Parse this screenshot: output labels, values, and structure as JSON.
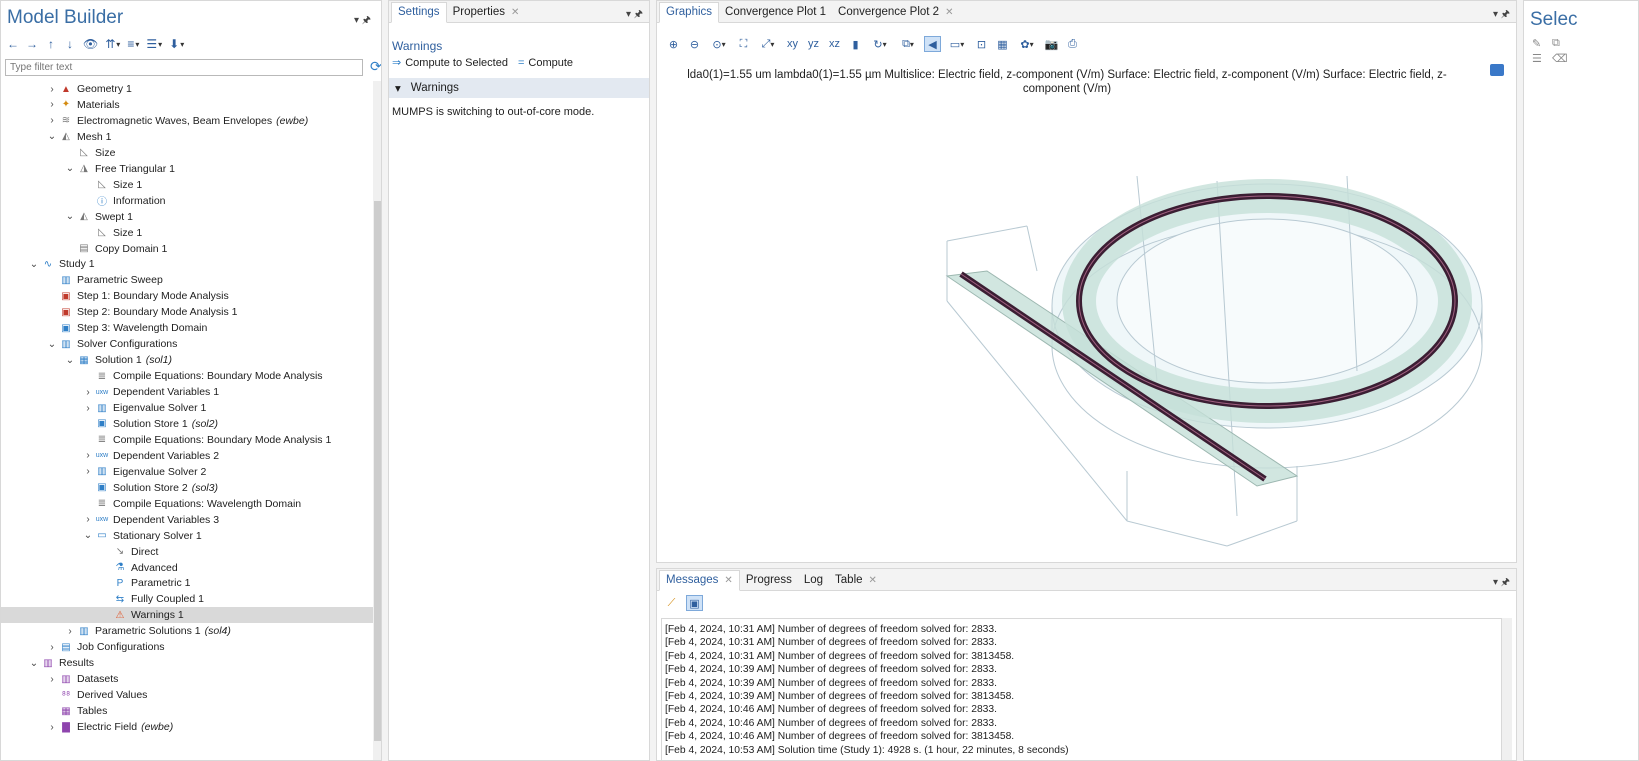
{
  "model_builder": {
    "title": "Model Builder",
    "filter_placeholder": "Type filter text",
    "toolbar_icons": [
      "arrow-left-icon",
      "arrow-right-icon",
      "arrow-up-icon",
      "arrow-down-icon",
      "visibility-icon",
      "expand-icon",
      "collapse-icon",
      "list-icon",
      "pin-icon"
    ],
    "tree": [
      {
        "label": "Geometry 1",
        "suffix": "",
        "level": 2,
        "tw": "›",
        "icon": "geometry-icon",
        "color": "#c0392b"
      },
      {
        "label": "Materials",
        "suffix": "",
        "level": 2,
        "tw": "›",
        "icon": "materials-icon",
        "color": "#d48b10"
      },
      {
        "label": "Electromagnetic Waves, Beam Envelopes",
        "suffix": "(ewbe)",
        "level": 2,
        "tw": "›",
        "icon": "waves-icon",
        "color": "#777"
      },
      {
        "label": "Mesh 1",
        "suffix": "",
        "level": 2,
        "tw": "⌄",
        "icon": "mesh-icon",
        "color": "#777"
      },
      {
        "label": "Size",
        "suffix": "",
        "level": 3,
        "tw": "",
        "icon": "size-icon",
        "color": "#777"
      },
      {
        "label": "Free Triangular 1",
        "suffix": "",
        "level": 3,
        "tw": "⌄",
        "icon": "triangular-icon",
        "color": "#777"
      },
      {
        "label": "Size 1",
        "suffix": "",
        "level": 4,
        "tw": "",
        "icon": "size-icon",
        "color": "#777"
      },
      {
        "label": "Information",
        "suffix": "",
        "level": 4,
        "tw": "",
        "icon": "info-icon",
        "color": "#2f7fc7"
      },
      {
        "label": "Swept 1",
        "suffix": "",
        "level": 3,
        "tw": "⌄",
        "icon": "swept-icon",
        "color": "#777"
      },
      {
        "label": "Size 1",
        "suffix": "",
        "level": 4,
        "tw": "",
        "icon": "size-icon",
        "color": "#777"
      },
      {
        "label": "Copy Domain 1",
        "suffix": "",
        "level": 3,
        "tw": "",
        "icon": "copy-domain-icon",
        "color": "#777"
      },
      {
        "label": "Study 1",
        "suffix": "",
        "level": 1,
        "tw": "⌄",
        "icon": "study-icon",
        "color": "#2f7fc7"
      },
      {
        "label": "Parametric Sweep",
        "suffix": "",
        "level": 2,
        "tw": "",
        "icon": "parametric-sweep-icon",
        "color": "#2f7fc7"
      },
      {
        "label": "Step 1: Boundary Mode Analysis",
        "suffix": "",
        "level": 2,
        "tw": "",
        "icon": "step-icon",
        "color": "#c0392b"
      },
      {
        "label": "Step 2: Boundary Mode Analysis 1",
        "suffix": "",
        "level": 2,
        "tw": "",
        "icon": "step-icon",
        "color": "#c0392b"
      },
      {
        "label": "Step 3: Wavelength Domain",
        "suffix": "",
        "level": 2,
        "tw": "",
        "icon": "step-icon",
        "color": "#2f7fc7"
      },
      {
        "label": "Solver Configurations",
        "suffix": "",
        "level": 2,
        "tw": "⌄",
        "icon": "solver-config-icon",
        "color": "#2f7fc7"
      },
      {
        "label": "Solution 1",
        "suffix": "(sol1)",
        "level": 3,
        "tw": "⌄",
        "icon": "solution-icon",
        "color": "#2f7fc7"
      },
      {
        "label": "Compile Equations: Boundary Mode Analysis",
        "suffix": "",
        "level": 4,
        "tw": "",
        "icon": "compile-icon",
        "color": "#777"
      },
      {
        "label": "Dependent Variables 1",
        "suffix": "",
        "level": 4,
        "tw": "›",
        "icon": "variables-icon",
        "color": "#2f7fc7"
      },
      {
        "label": "Eigenvalue Solver 1",
        "suffix": "",
        "level": 4,
        "tw": "›",
        "icon": "eigen-icon",
        "color": "#2f7fc7"
      },
      {
        "label": "Solution Store 1",
        "suffix": "(sol2)",
        "level": 4,
        "tw": "",
        "icon": "store-icon",
        "color": "#2f7fc7"
      },
      {
        "label": "Compile Equations: Boundary Mode Analysis 1",
        "suffix": "",
        "level": 4,
        "tw": "",
        "icon": "compile-icon",
        "color": "#777"
      },
      {
        "label": "Dependent Variables 2",
        "suffix": "",
        "level": 4,
        "tw": "›",
        "icon": "variables-icon",
        "color": "#2f7fc7"
      },
      {
        "label": "Eigenvalue Solver 2",
        "suffix": "",
        "level": 4,
        "tw": "›",
        "icon": "eigen-icon",
        "color": "#2f7fc7"
      },
      {
        "label": "Solution Store 2",
        "suffix": "(sol3)",
        "level": 4,
        "tw": "",
        "icon": "store-icon",
        "color": "#2f7fc7"
      },
      {
        "label": "Compile Equations: Wavelength Domain",
        "suffix": "",
        "level": 4,
        "tw": "",
        "icon": "compile-icon",
        "color": "#777"
      },
      {
        "label": "Dependent Variables 3",
        "suffix": "",
        "level": 4,
        "tw": "›",
        "icon": "variables-icon",
        "color": "#2f7fc7"
      },
      {
        "label": "Stationary Solver 1",
        "suffix": "",
        "level": 4,
        "tw": "⌄",
        "icon": "stationary-icon",
        "color": "#2f7fc7"
      },
      {
        "label": "Direct",
        "suffix": "",
        "level": 5,
        "tw": "",
        "icon": "direct-icon",
        "color": "#777"
      },
      {
        "label": "Advanced",
        "suffix": "",
        "level": 5,
        "tw": "",
        "icon": "advanced-icon",
        "color": "#2f7fc7"
      },
      {
        "label": "Parametric 1",
        "suffix": "",
        "level": 5,
        "tw": "",
        "icon": "parametric-icon",
        "color": "#2f7fc7"
      },
      {
        "label": "Fully Coupled 1",
        "suffix": "",
        "level": 5,
        "tw": "",
        "icon": "coupled-icon",
        "color": "#2f7fc7"
      },
      {
        "label": "Warnings 1",
        "suffix": "",
        "level": 5,
        "tw": "",
        "icon": "warning-icon",
        "color": "#e0572b",
        "selected": true
      },
      {
        "label": "Parametric Solutions 1",
        "suffix": "(sol4)",
        "level": 3,
        "tw": "›",
        "icon": "param-solutions-icon",
        "color": "#2f7fc7"
      },
      {
        "label": "Job Configurations",
        "suffix": "",
        "level": 2,
        "tw": "›",
        "icon": "job-icon",
        "color": "#2f7fc7"
      },
      {
        "label": "Results",
        "suffix": "",
        "level": 1,
        "tw": "⌄",
        "icon": "results-icon",
        "color": "#8e44ad"
      },
      {
        "label": "Datasets",
        "suffix": "",
        "level": 2,
        "tw": "›",
        "icon": "datasets-icon",
        "color": "#8e44ad"
      },
      {
        "label": "Derived Values",
        "suffix": "",
        "level": 2,
        "tw": "",
        "icon": "derived-icon",
        "color": "#8e44ad"
      },
      {
        "label": "Tables",
        "suffix": "",
        "level": 2,
        "tw": "",
        "icon": "tables-icon",
        "color": "#8e44ad"
      },
      {
        "label": "Electric Field",
        "suffix": "(ewbe)",
        "level": 2,
        "tw": "›",
        "icon": "plot-group-icon",
        "color": "#8e44ad"
      }
    ]
  },
  "settings": {
    "tabs": [
      {
        "label": "Settings",
        "active": true,
        "close": false
      },
      {
        "label": "Properties",
        "active": false,
        "close": true
      }
    ],
    "subtitle": "Warnings",
    "actions": [
      {
        "label": "Compute to Selected",
        "icon": "compute-selected-icon"
      },
      {
        "label": "Compute",
        "icon": "compute-icon"
      }
    ],
    "section": "Warnings",
    "message": "MUMPS is switching to out-of-core mode."
  },
  "graphics": {
    "tabs": [
      {
        "label": "Graphics",
        "active": true,
        "close": false
      },
      {
        "label": "Convergence Plot 1",
        "active": false,
        "close": false
      },
      {
        "label": "Convergence Plot 2",
        "active": false,
        "close": true
      }
    ],
    "plot_title": "lda0(1)=1.55 um lambda0(1)=1.55 µm  Multislice: Electric field, z-component (V/m)  Surface: Electric field, z-component (V/m)  Surface: Electric field, z-component (V/m)",
    "ring_color": "#3b1e33",
    "domain_color": "#cfe6e3"
  },
  "messages": {
    "tabs": [
      {
        "label": "Messages",
        "active": true,
        "close": true
      },
      {
        "label": "Progress",
        "active": false,
        "close": false
      },
      {
        "label": "Log",
        "active": false,
        "close": false
      },
      {
        "label": "Table",
        "active": false,
        "close": true
      }
    ],
    "lines": [
      "[Feb 4, 2024, 10:31 AM] Number of degrees of freedom solved for: 2833.",
      "[Feb 4, 2024, 10:31 AM] Number of degrees of freedom solved for: 2833.",
      "[Feb 4, 2024, 10:31 AM] Number of degrees of freedom solved for: 3813458.",
      "[Feb 4, 2024, 10:39 AM] Number of degrees of freedom solved for: 2833.",
      "[Feb 4, 2024, 10:39 AM] Number of degrees of freedom solved for: 2833.",
      "[Feb 4, 2024, 10:39 AM] Number of degrees of freedom solved for: 3813458.",
      "[Feb 4, 2024, 10:46 AM] Number of degrees of freedom solved for: 2833.",
      "[Feb 4, 2024, 10:46 AM] Number of degrees of freedom solved for: 2833.",
      "[Feb 4, 2024, 10:46 AM] Number of degrees of freedom solved for: 3813458.",
      "[Feb 4, 2024, 10:53 AM] Solution time (Study 1): 4928 s. (1 hour, 22 minutes, 8 seconds)"
    ]
  },
  "selection": {
    "title": "Selec"
  }
}
